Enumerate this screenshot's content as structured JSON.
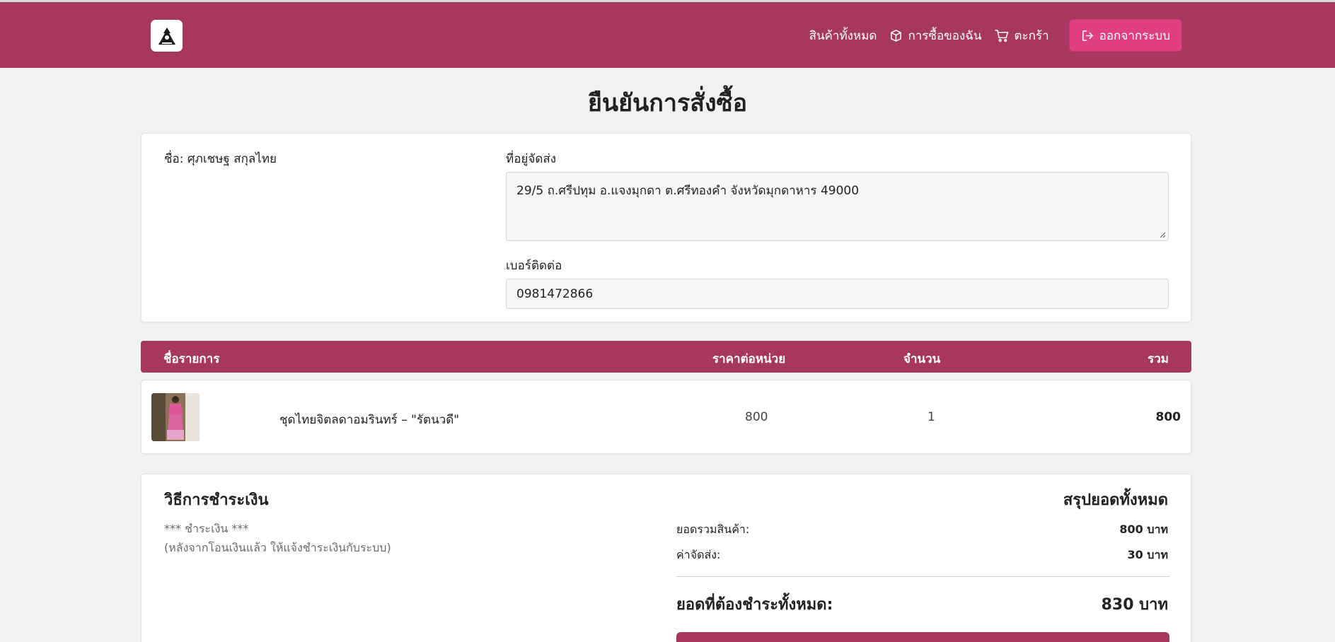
{
  "colors": {
    "primary": "#a6385f",
    "logout": "#e0407f",
    "background": "#f2f2f2"
  },
  "nav": {
    "logo_icon": "logo-icon",
    "links": [
      {
        "label": "สินค้าทั้งหมด",
        "icon": ""
      },
      {
        "label": "การซื้อของฉัน",
        "icon": "box-icon"
      },
      {
        "label": "ตะกร้า",
        "icon": "cart-icon"
      }
    ],
    "logout": {
      "label": "ออกจากระบบ",
      "icon": "logout-icon"
    }
  },
  "page": {
    "title": "ยืนยันการสั่งซื้อ"
  },
  "customer": {
    "name_line": "ชื่อ: ศุภเชษฐ สกุลไทย",
    "address_label": "ที่อยู่จัดส่ง",
    "address_value": "29/5 ถ.ศรีปทุม อ.แจงมุกดา ต.ศรีทองคำ จังหวัดมุกดาหาร 49000",
    "phone_label": "เบอร์ติดต่อ",
    "phone_value": "0981472866"
  },
  "table": {
    "headers": {
      "name": "ชื่อรายการ",
      "unit_price": "ราคาต่อหน่วย",
      "quantity": "จำนวน",
      "total": "รวม"
    },
    "rows": [
      {
        "name": "ชุดไทยจิตลดาอมรินทร์ – \"รัตนวดี\"",
        "unit_price": "800",
        "quantity": "1",
        "total": "800"
      }
    ]
  },
  "payment": {
    "title": "วิธีการชำระเงิน",
    "note_line1": "*** ชำระเงิน ***",
    "note_line2": "(หลังจากโอนเงินแล้ว ให้แจ้งชำระเงินกับระบบ)"
  },
  "summary": {
    "title": "สรุปยอดทั้งหมด",
    "subtotal_label": "ยอดรวมสินค้า:",
    "subtotal_value": "800 บาท",
    "shipping_label": "ค่าจัดส่ง:",
    "shipping_value": "30 บาท",
    "total_label": "ยอดที่ต้องชำระทั้งหมด:",
    "total_value": "830 บาท"
  }
}
